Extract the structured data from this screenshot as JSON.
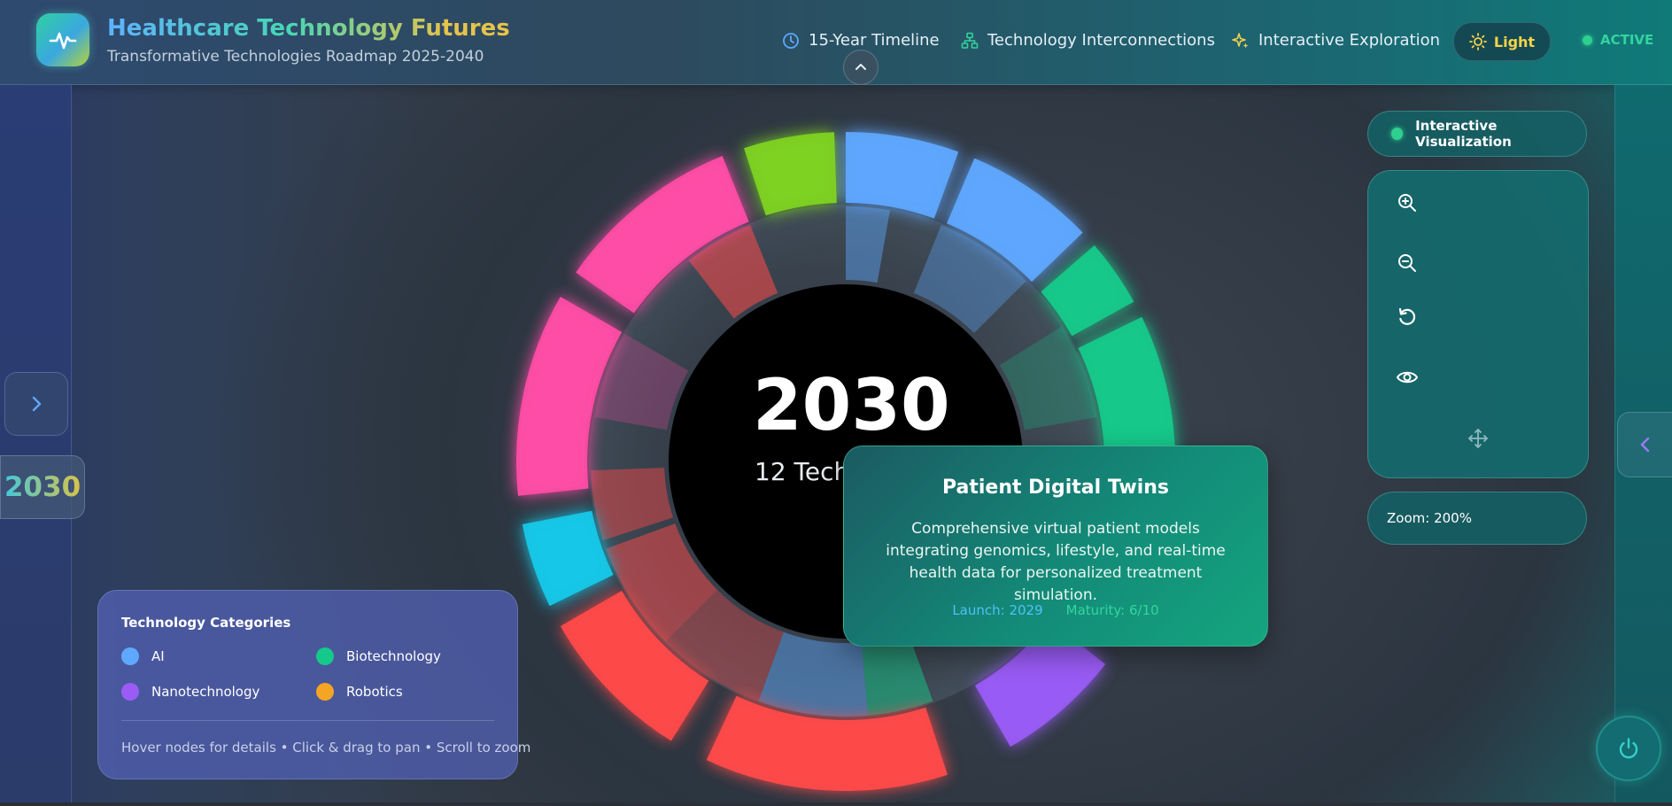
{
  "header": {
    "title": "Healthcare Technology Futures",
    "subtitle": "Transformative Technologies Roadmap 2025-2040",
    "nav": [
      {
        "label": "15-Year Timeline",
        "icon": "clock-icon"
      },
      {
        "label": "Technology Interconnections",
        "icon": "network-icon"
      },
      {
        "label": "Interactive Exploration",
        "icon": "sparkle-icon"
      }
    ],
    "theme_label": "Light",
    "status_label": "ACTIVE"
  },
  "sidebar": {
    "year": "2030"
  },
  "wheel": {
    "center_year": "2030",
    "center_sub": "12 Tech",
    "categories_colors": {
      "AI": "#5fa8ff",
      "Biotechnology": "#14c98a",
      "Nanotechnology": "#9a5cf5",
      "Robotics": "#f5a524",
      "Pink": "#ff4da6",
      "Red": "#ff4a4a",
      "Lime": "#7ed321",
      "Cyan": "#16c8e8"
    }
  },
  "tooltip": {
    "title": "Patient Digital Twins",
    "description": "Comprehensive virtual patient models integrating genomics, lifestyle, and real-time health data for personalized treatment simulation.",
    "launch": "Launch: 2029",
    "maturity": "Maturity: 6/10"
  },
  "controls": {
    "badge": "Interactive Visualization",
    "zoom_in": "zoom-in-icon",
    "zoom_out": "zoom-out-icon",
    "reset": "reset-icon",
    "view": "eye-icon",
    "pan": "move-icon",
    "zoom_label": "Zoom: 200%"
  },
  "legend": {
    "title": "Technology Categories",
    "items": [
      {
        "label": "AI",
        "color": "#5fa8ff"
      },
      {
        "label": "Biotechnology",
        "color": "#14c98a"
      },
      {
        "label": "Nanotechnology",
        "color": "#9a5cf5"
      },
      {
        "label": "Robotics",
        "color": "#f5a524"
      }
    ],
    "hint": "Hover nodes for details • Click & drag to pan • Scroll to zoom"
  }
}
